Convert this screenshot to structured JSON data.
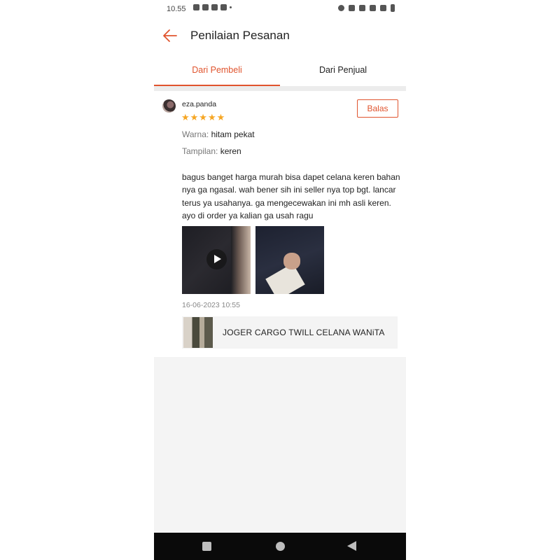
{
  "status_bar": {
    "time": "10.55",
    "left_icons": [
      "notification-icon",
      "notification-icon",
      "tiktok-icon",
      "mail-icon",
      "mail-icon"
    ],
    "right_icons": [
      "alarm-icon",
      "vibrate-icon",
      "volte-icon",
      "wifi-icon",
      "signal-icon",
      "battery-icon"
    ]
  },
  "header": {
    "title": "Penilaian Pesanan",
    "back_icon": "arrow-left-icon"
  },
  "tabs": [
    {
      "label": "Dari Pembeli",
      "active": true
    },
    {
      "label": "Dari Penjual",
      "active": false
    }
  ],
  "review": {
    "username": "eza.panda",
    "stars": "★★★★★",
    "rating": 5,
    "reply_label": "Balas",
    "attributes": [
      {
        "key": "Warna:",
        "value": "hitam pekat"
      },
      {
        "key": "Tampilan:",
        "value": "keren"
      }
    ],
    "comment": "bagus banget harga murah bisa dapet celana keren bahan nya ga ngasal. wah bener sih ini seller nya top bgt. lancar terus ya usahanya. ga mengecewakan ini mh asli keren. ayo di order ya kalian ga usah ragu",
    "date": "16-06-2023 10:55",
    "product_name": "JOGER CARGO TWILL CELANA WANiTA"
  },
  "colors": {
    "accent": "#e0542e",
    "star": "#f6a623",
    "navbar": "#0a0a0a"
  }
}
